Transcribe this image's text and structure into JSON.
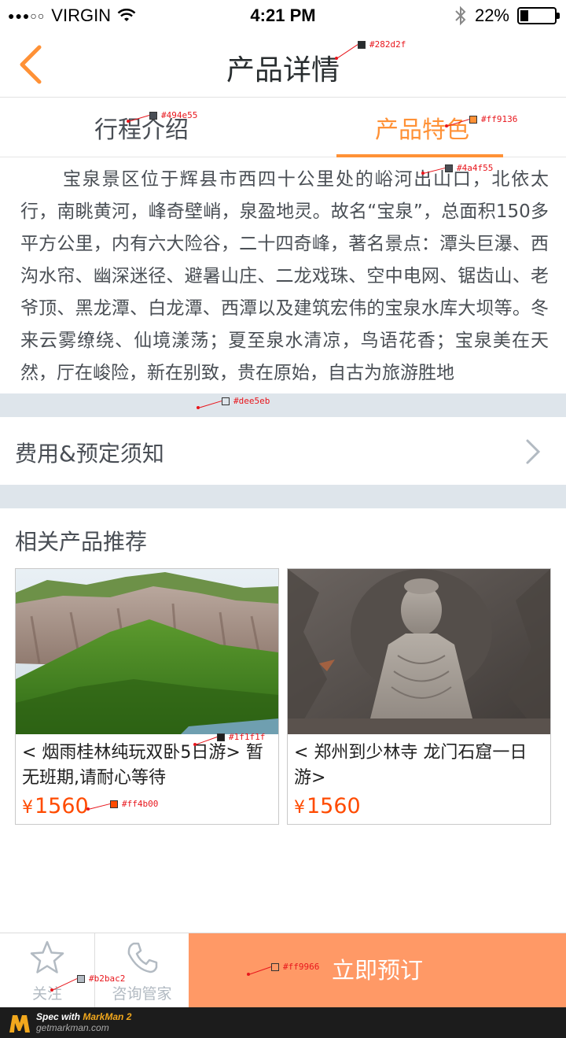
{
  "status_bar": {
    "carrier": "VIRGIN",
    "time": "4:21 PM",
    "battery": "22%",
    "battery_level": 0.22
  },
  "nav": {
    "title": "产品详情"
  },
  "tabs": [
    {
      "label": "行程介绍",
      "active": false
    },
    {
      "label": "产品特色",
      "active": true
    }
  ],
  "description": "宝泉景区位于辉县市西四十公里处的峪河出山口，北依太行，南眺黄河，峰奇壁峭，泉盈地灵。故名“宝泉”，总面积150多平方公里，内有六大险谷，二十四奇峰，著名景点：潭头巨瀑、西沟水帘、幽深迷径、避暑山庄、二龙戏珠、空中电网、锯齿山、老爷顶、黑龙潭、白龙潭、西潭以及建筑宏伟的宝泉水库大坝等。冬来云雾缭绕、仙境漾荡；夏至泉水清凉，鸟语花香；宝泉美在天然，厅在峻险，新在别致，贵在原始，自古为旅游胜地",
  "fees": {
    "label": "费用&预定须知"
  },
  "recommend": {
    "title": "相关产品推荐",
    "products": [
      {
        "name": "< 烟雨桂林纯玩双卧5日游> 暂无班期,请耐心等待",
        "currency": "¥",
        "price": "1560",
        "image": "mountain-landscape"
      },
      {
        "name": "< 郑州到少林寺 龙门石窟一日 游>",
        "currency": "¥",
        "price": "1560",
        "image": "buddha-statue"
      }
    ]
  },
  "bottom_bar": {
    "follow_label": "关注",
    "consult_label": "咨询管家",
    "book_label": "立即预订"
  },
  "watermark": {
    "line1_prefix": "Spec with ",
    "line1_brand": "MarkMan 2",
    "line2": "getmarkman.com"
  },
  "spec_colors": {
    "title": "#282d2f",
    "tab_inactive": "#494e55",
    "tab_active": "#ff9136",
    "body_text": "#4a4f55",
    "divider": "#dee5eb",
    "product_name": "#1f1f1f",
    "price": "#ff4b00",
    "icon_gray": "#b2bac2",
    "book_button": "#ff9966"
  },
  "spec_labels": [
    "#282d2f",
    "#494e55",
    "#ff9136",
    "#4a4f55",
    "#dee5eb",
    "#1f1f1f",
    "#ff4b00",
    "#b2bac2",
    "#ff9966"
  ]
}
